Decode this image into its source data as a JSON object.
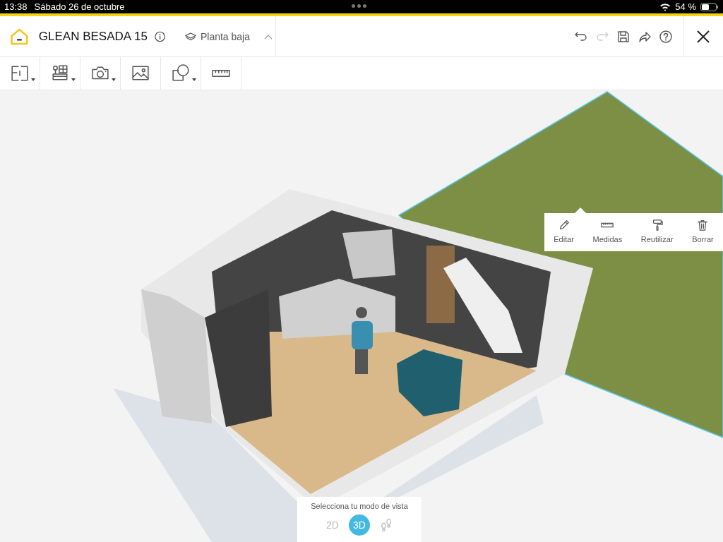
{
  "status_bar": {
    "time": "13:38",
    "date": "Sábado 26 de octubre",
    "battery": "54 %"
  },
  "header": {
    "title": "GLEAN BESADA 15",
    "floor": "Planta baja"
  },
  "header_actions": [
    {
      "kind": "undo",
      "disabled": false
    },
    {
      "kind": "redo",
      "disabled": true
    },
    {
      "kind": "save",
      "disabled": false
    },
    {
      "kind": "share",
      "disabled": false
    },
    {
      "kind": "help",
      "disabled": false
    }
  ],
  "toolbar": [
    {
      "kind": "plan",
      "menu": true
    },
    {
      "kind": "furniture",
      "menu": true
    },
    {
      "kind": "camera",
      "menu": true
    },
    {
      "kind": "image",
      "menu": false
    },
    {
      "kind": "shapes",
      "menu": true
    },
    {
      "kind": "ruler",
      "menu": false
    }
  ],
  "context_menu": [
    {
      "kind": "edit",
      "label": "Editar"
    },
    {
      "kind": "measure",
      "label": "Medidas"
    },
    {
      "kind": "reuse",
      "label": "Reutilizar"
    },
    {
      "kind": "delete",
      "label": "Borrar"
    }
  ],
  "view_mode": {
    "title": "Selecciona tu modo de vista",
    "modes": [
      {
        "kind": "text",
        "label": "2D",
        "selected": false
      },
      {
        "kind": "text",
        "label": "3D",
        "selected": true
      },
      {
        "kind": "walk",
        "selected": false
      }
    ]
  }
}
